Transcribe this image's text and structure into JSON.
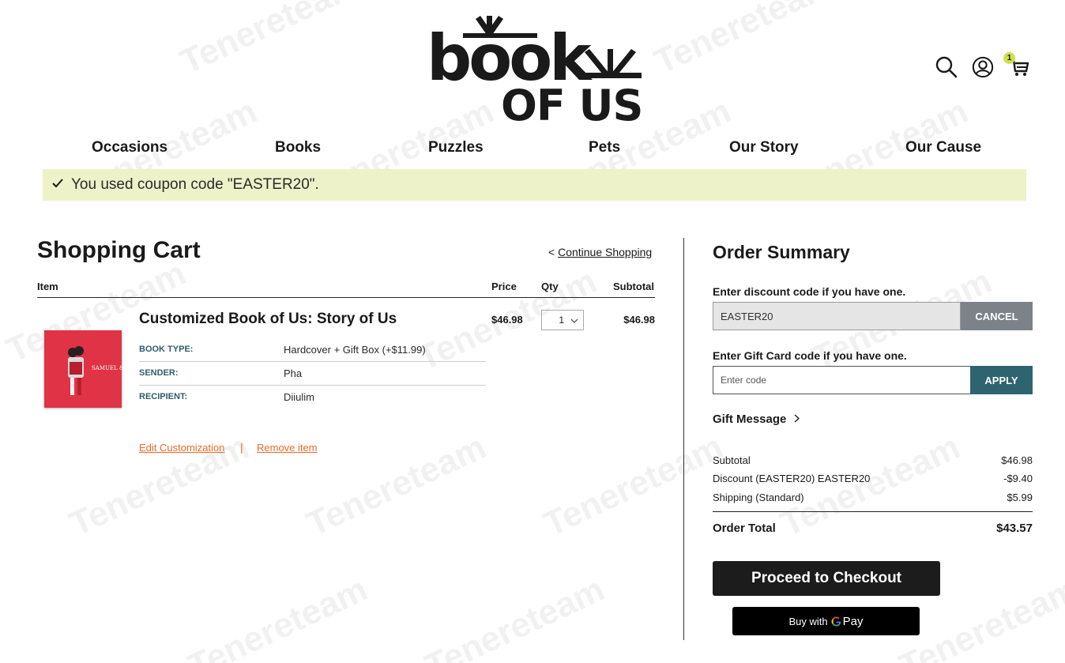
{
  "brand": {
    "logo_line1": "book",
    "logo_line2": "OF US"
  },
  "header": {
    "cart_count": "1"
  },
  "nav": [
    "Occasions",
    "Books",
    "Puzzles",
    "Pets",
    "Our Story",
    "Our Cause"
  ],
  "notice": {
    "message": "You used coupon code \"EASTER20\".",
    "color": "#eef2c9"
  },
  "cart": {
    "title": "Shopping Cart",
    "continue_prefix": "<",
    "continue_link": "Continue Shopping",
    "columns": {
      "item": "Item",
      "price": "Price",
      "qty": "Qty",
      "subtotal": "Subtotal"
    },
    "item": {
      "name": "Customized Book of Us: Story of Us",
      "cover_text": "SAMUEL & ESME",
      "options": [
        {
          "key": "BOOK TYPE:",
          "value": "Hardcover + Gift Box (+$11.99)"
        },
        {
          "key": "SENDER:",
          "value": "Pha"
        },
        {
          "key": "RECIPIENT:",
          "value": "Diiulim"
        }
      ],
      "price": "$46.98",
      "qty": "1",
      "subtotal": "$46.98",
      "edit_label": "Edit Customization",
      "separator": "|",
      "remove_label": "Remove item"
    }
  },
  "summary": {
    "title": "Order Summary",
    "discount_label": "Enter discount code if you have one.",
    "discount_value": "EASTER20",
    "cancel_label": "CANCEL",
    "gift_label": "Enter Gift Card code if you have one.",
    "gift_placeholder": "Enter code",
    "apply_label": "APPLY",
    "gift_message": "Gift Message",
    "rows": [
      {
        "label": "Subtotal",
        "value": "$46.98"
      },
      {
        "label": "Discount (EASTER20) EASTER20",
        "value": "-$9.40"
      },
      {
        "label": "Shipping (Standard)",
        "value": "$5.99"
      }
    ],
    "total_label": "Order Total",
    "total_value": "$43.57",
    "checkout_label": "Proceed to Checkout",
    "gpay_prefix": "Buy with",
    "gpay_label": "Pay"
  },
  "watermark": "Tenereteam",
  "colors": {
    "accent_orange": "#e76a2a",
    "teal": "#2e6470",
    "cancel_gray": "#7c8288",
    "badge": "#cfe04a"
  }
}
